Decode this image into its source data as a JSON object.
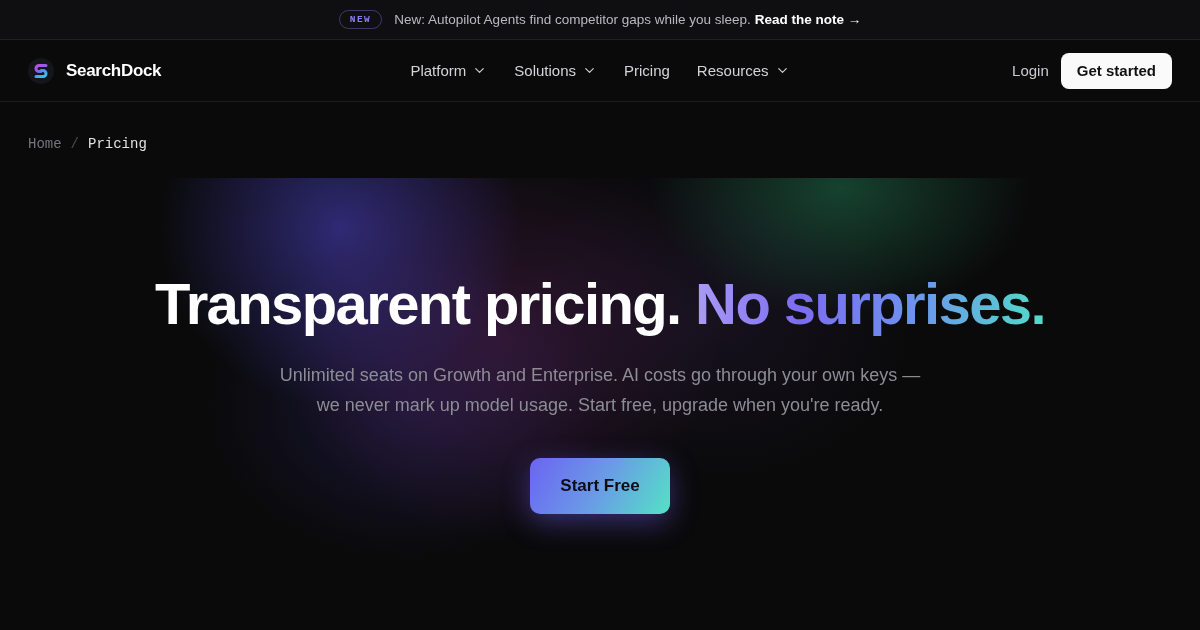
{
  "announcement": {
    "badge": "NEW",
    "text": "New: Autopilot Agents find competitor gaps while you sleep.",
    "link": "Read the note →"
  },
  "nav": {
    "brand": "SearchDock",
    "items": [
      {
        "label": "Platform",
        "dropdown": true
      },
      {
        "label": "Solutions",
        "dropdown": true
      },
      {
        "label": "Pricing",
        "dropdown": false
      },
      {
        "label": "Resources",
        "dropdown": true
      }
    ],
    "login": "Login",
    "cta": "Get started"
  },
  "breadcrumb": {
    "separator": "/",
    "items": [
      {
        "label": "Home",
        "current": false
      },
      {
        "label": "Pricing",
        "current": true
      }
    ]
  },
  "hero": {
    "title": "Transparent pricing.",
    "title_highlight": "No surprises.",
    "subtitle": "Unlimited seats on Growth and Enterprise. AI costs go through your own keys — we never mark up model usage. Start free, upgrade when you're ready.",
    "cta": "Start Free"
  }
}
